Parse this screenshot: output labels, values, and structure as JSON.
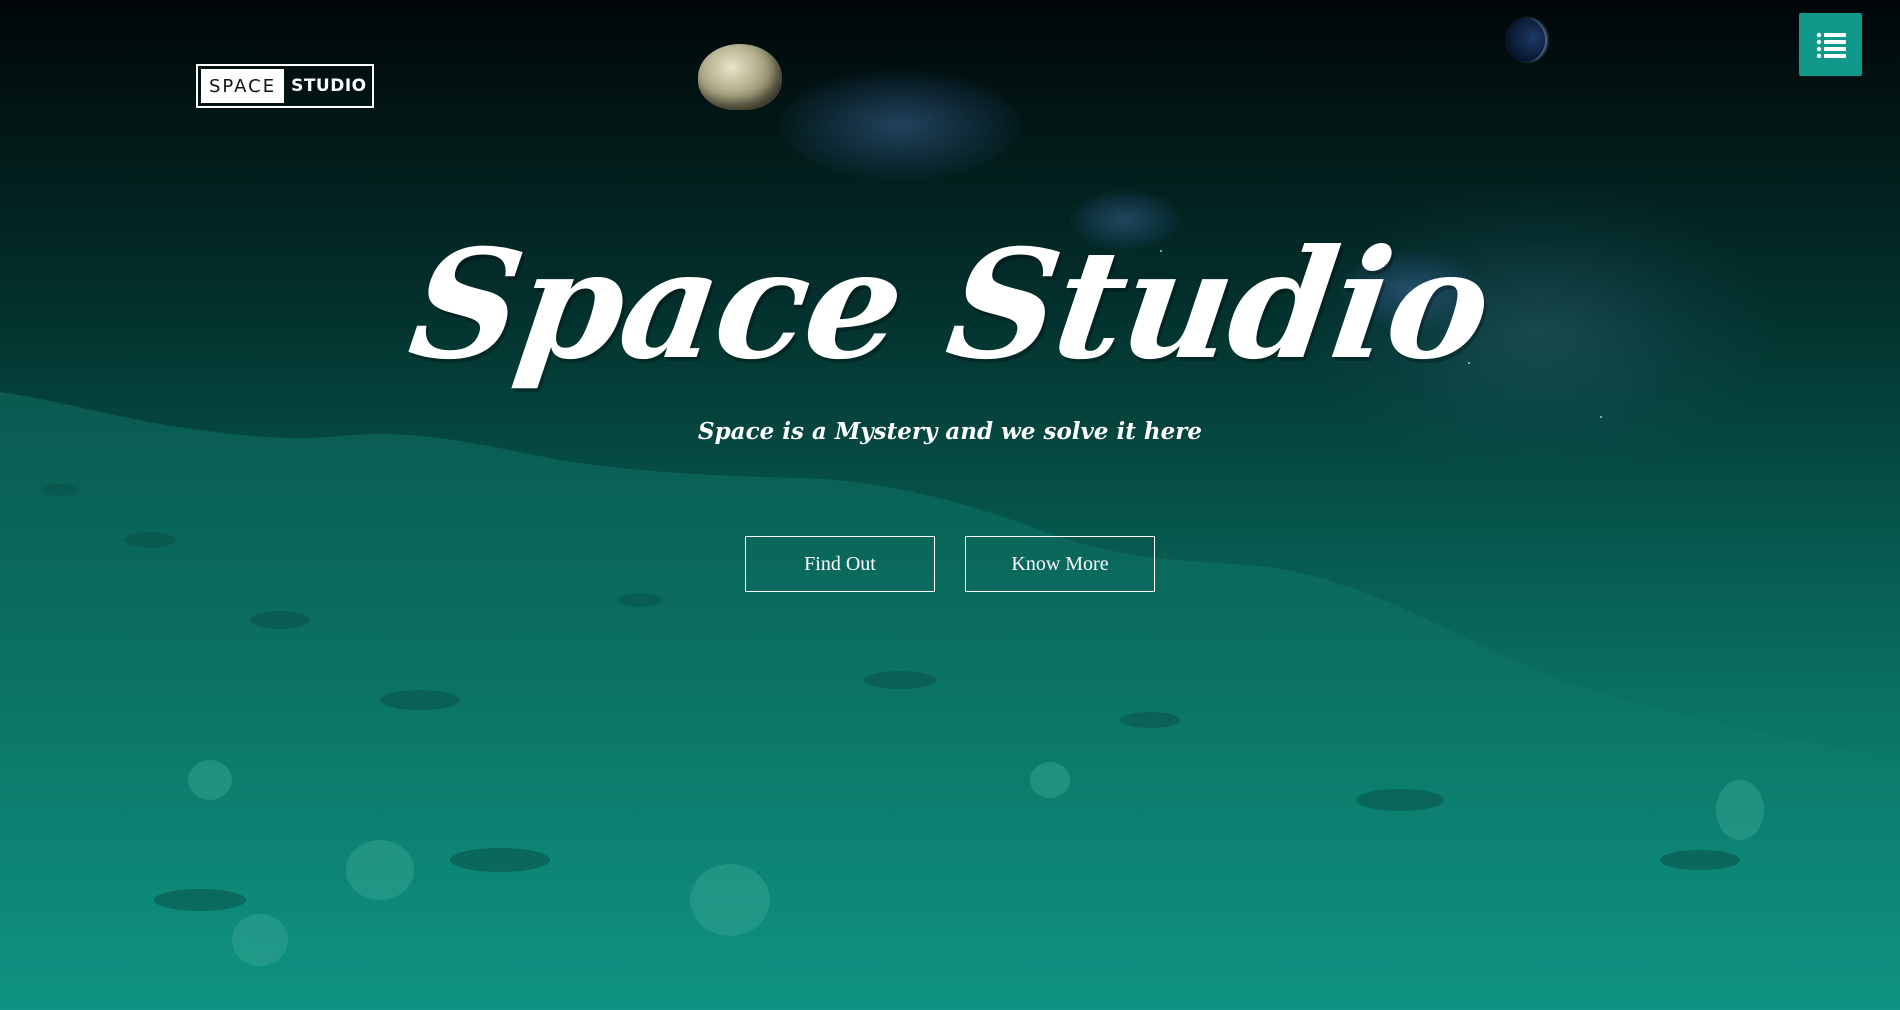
{
  "logo": {
    "left_text": "SPACE",
    "right_text": "STUDIO"
  },
  "menu": {
    "icon": "list-menu-icon",
    "color": "#10998a"
  },
  "hero": {
    "title": "Space Studio",
    "subtitle": "Space is a Mystery and we solve it here"
  },
  "buttons": {
    "find_out": "Find Out",
    "know_more": "Know More"
  },
  "colors": {
    "accent": "#10998a",
    "text": "#ffffff"
  }
}
